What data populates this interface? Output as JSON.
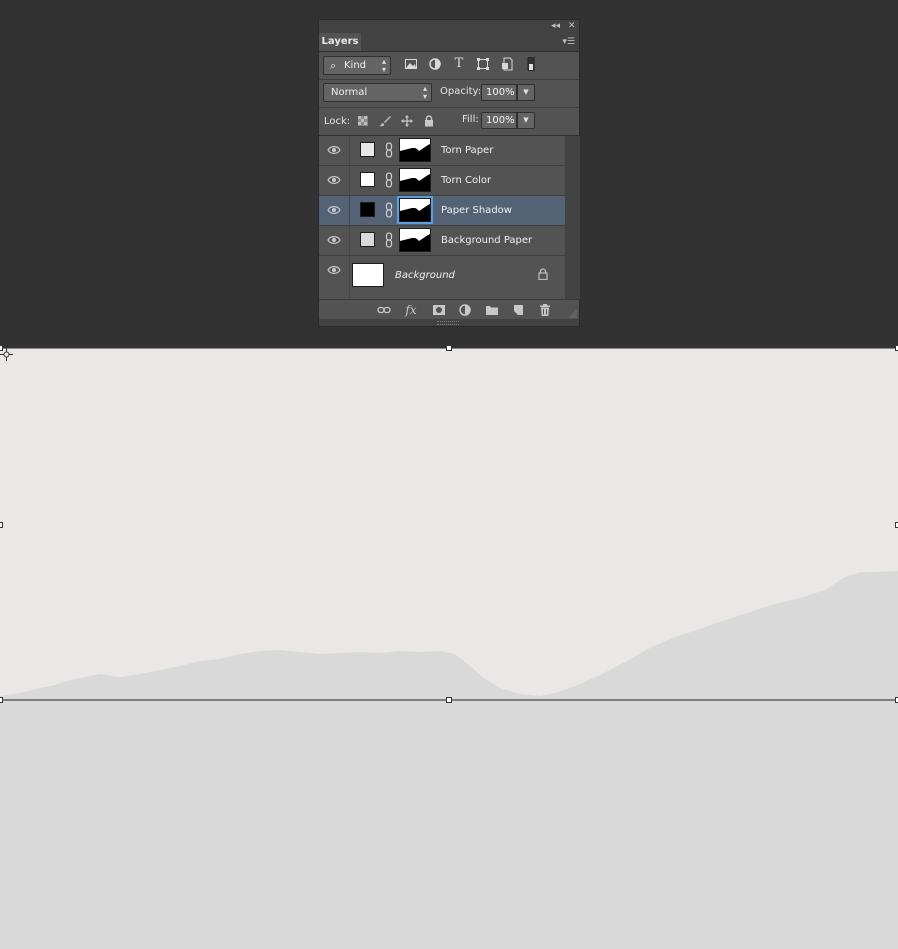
{
  "panel": {
    "tab_label": "Layers",
    "filter": {
      "kind_label": "Kind"
    },
    "blend_mode": "Normal",
    "opacity_label": "Opacity:",
    "opacity_value": "100%",
    "lock_label": "Lock:",
    "fill_label": "Fill:",
    "fill_value": "100%",
    "layers": [
      {
        "name": "Torn Paper",
        "swatch_color": "#e8e8e8",
        "visible": true,
        "selected": false
      },
      {
        "name": "Torn Color",
        "swatch_color": "#ffffff",
        "visible": true,
        "selected": false
      },
      {
        "name": "Paper Shadow",
        "swatch_color": "#000000",
        "visible": true,
        "selected": true
      },
      {
        "name": "Background Paper",
        "swatch_color": "#d9d9d9",
        "visible": true,
        "selected": false
      }
    ],
    "background_layer": {
      "name": "Background",
      "locked": true
    },
    "footer_icons": [
      "link-icon",
      "fx-icon",
      "mask-icon",
      "adjustment-icon",
      "folder-icon",
      "new-layer-icon",
      "trash-icon"
    ]
  },
  "canvas": {
    "top_color": "#ebe7e7",
    "bottom_color": "#d9d9d9"
  }
}
